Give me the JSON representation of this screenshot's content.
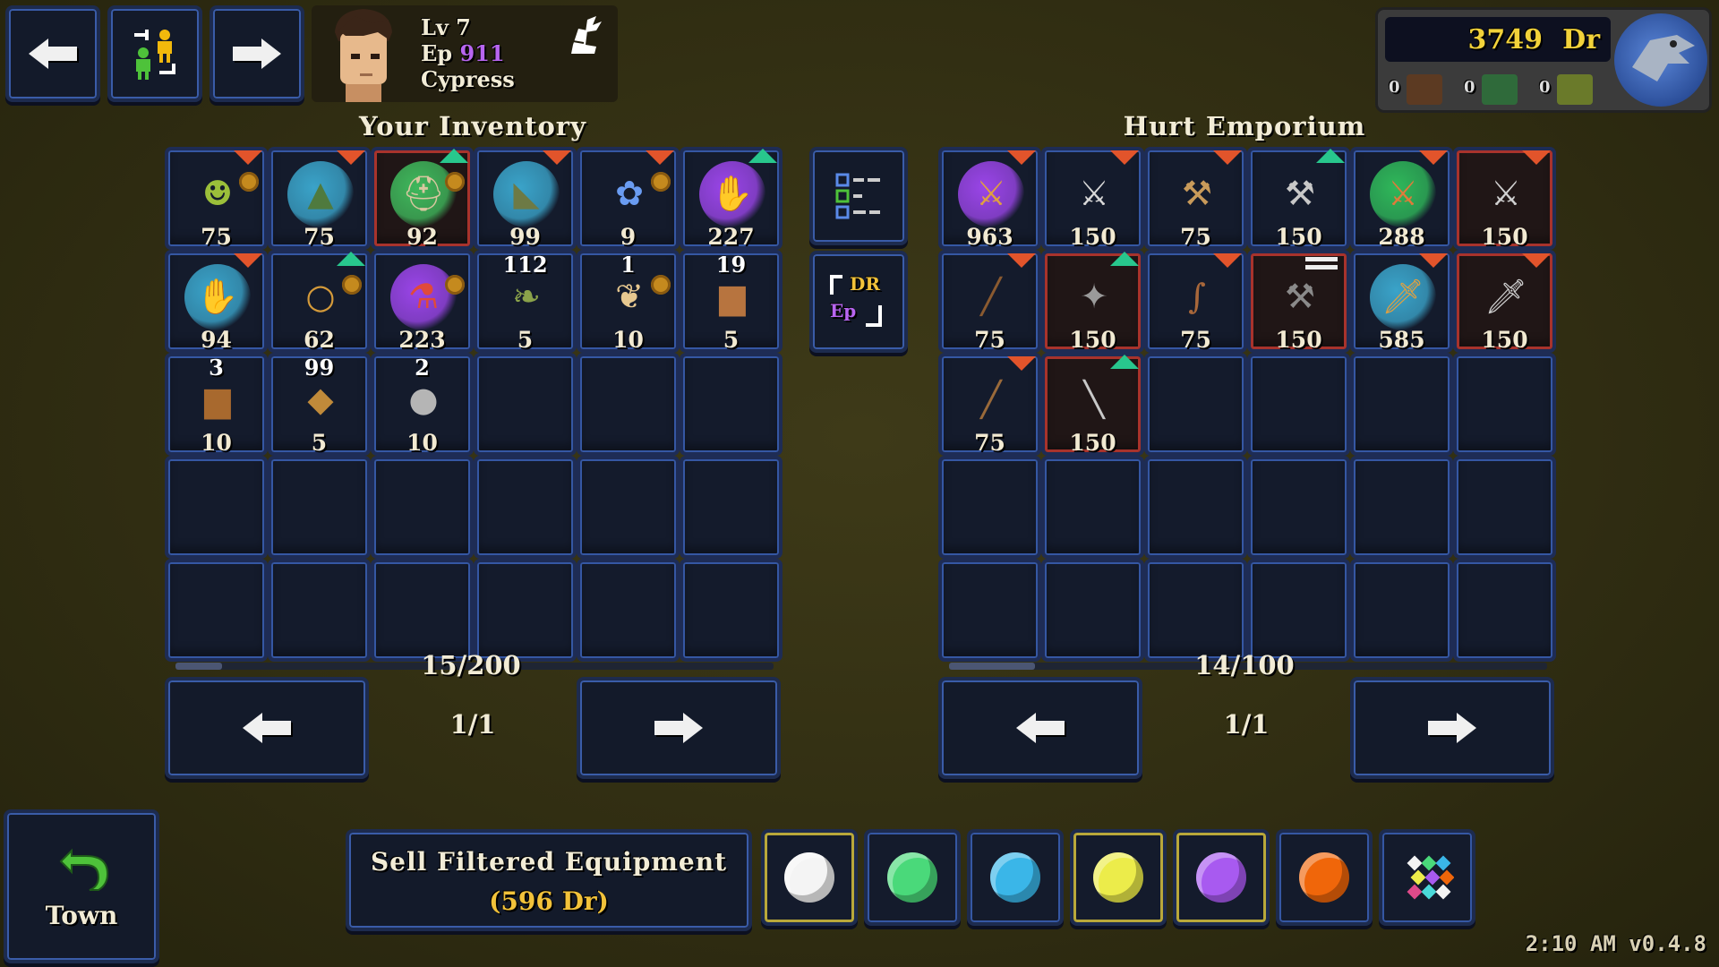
{
  "topbar": {
    "nav_back_icon": "arrow-left-icon",
    "swap_icon": "swap-characters-icon",
    "nav_forward_icon": "arrow-right-icon",
    "character": {
      "level_label": "Lv 7",
      "ep_label": "Ep",
      "ep_value": "911",
      "name": "Cypress",
      "ep_color": "#b865f0"
    },
    "class_icon": "winged-boot-icon"
  },
  "currency": {
    "amount": "3749",
    "unit": "Dr",
    "counts": [
      "0",
      "0",
      "0"
    ],
    "color": "#f2d23a"
  },
  "inventory": {
    "title": "Your Inventory",
    "capacity": "15/200",
    "page": "1/1",
    "slots": [
      {
        "icon": "goblin-mask-icon",
        "glyph": "☻",
        "color": "#9bbf3a",
        "qty": "75",
        "glow": "",
        "marker": "down",
        "coin": true
      },
      {
        "icon": "witch-hat-icon",
        "glyph": "▲",
        "color": "#4f7a3e",
        "qty": "75",
        "glow": "#3aa3c9",
        "marker": "down",
        "coin": false
      },
      {
        "icon": "helmet-icon",
        "glyph": "⛑",
        "color": "#d9c7a0",
        "qty": "92",
        "glow": "#3fb85c",
        "marker": "up",
        "coin": true,
        "red": true
      },
      {
        "icon": "boots-icon",
        "glyph": "◣",
        "color": "#6d7a45",
        "qty": "99",
        "glow": "#3aa3c9",
        "marker": "down",
        "coin": false
      },
      {
        "icon": "blue-flower-icon",
        "glyph": "✿",
        "color": "#6a9cf2",
        "qty": "9",
        "glow": "",
        "marker": "down",
        "coin": true
      },
      {
        "icon": "glove-icon",
        "glyph": "✋",
        "color": "#b9744a",
        "qty": "227",
        "glow": "#9a45e8",
        "marker": "up",
        "coin": false
      },
      {
        "icon": "glove-icon",
        "glyph": "✋",
        "color": "#c48450",
        "qty": "94",
        "glow": "#3aa3c9",
        "marker": "down",
        "coin": false
      },
      {
        "icon": "ring-icon",
        "glyph": "○",
        "color": "#d49a3a",
        "qty": "62",
        "glow": "",
        "marker": "up",
        "coin": true
      },
      {
        "icon": "potion-icon",
        "glyph": "⚗",
        "color": "#e04a3a",
        "qty": "223",
        "glow": "#9a45e8",
        "marker": "",
        "coin": true
      },
      {
        "icon": "leaf-icon",
        "glyph": "❧",
        "color": "#8aa24a",
        "qty": "5",
        "count": "112",
        "glow": "",
        "marker": "",
        "coin": false
      },
      {
        "icon": "feather-icon",
        "glyph": "❦",
        "color": "#e7c890",
        "qty": "10",
        "count": "1",
        "glow": "",
        "marker": "",
        "coin": true
      },
      {
        "icon": "leather-icon",
        "glyph": "▆",
        "color": "#b7743f",
        "qty": "5",
        "count": "19",
        "glow": "",
        "marker": "",
        "coin": false
      },
      {
        "icon": "leather-icon",
        "glyph": "▆",
        "color": "#a8692e",
        "qty": "10",
        "count": "3",
        "glow": "",
        "marker": "",
        "coin": false
      },
      {
        "icon": "ore-icon",
        "glyph": "◆",
        "color": "#c08a3a",
        "qty": "5",
        "count": "99",
        "glow": "",
        "marker": "",
        "coin": false
      },
      {
        "icon": "stone-icon",
        "glyph": "●",
        "color": "#b5b5b5",
        "qty": "10",
        "count": "2",
        "glow": "",
        "marker": "",
        "coin": false
      }
    ]
  },
  "middle": {
    "filter_icon": "filter-list-icon",
    "convert_icon": "convert-dr-ep-icon",
    "convert_top": "DR",
    "convert_bottom": "Ep"
  },
  "shop": {
    "title": "Hurt Emporium",
    "capacity": "14/100",
    "page": "1/1",
    "slots": [
      {
        "icon": "sword-icon",
        "glyph": "⚔",
        "color": "#e0a040",
        "qty": "963",
        "glow": "#9a45e8",
        "marker": "down"
      },
      {
        "icon": "sword-icon",
        "glyph": "⚔",
        "color": "#d8d8d8",
        "qty": "150",
        "glow": "",
        "marker": "down"
      },
      {
        "icon": "axe-icon",
        "glyph": "⚒",
        "color": "#c89a5a",
        "qty": "75",
        "glow": "",
        "marker": "down"
      },
      {
        "icon": "axe-icon",
        "glyph": "⚒",
        "color": "#c8c8c8",
        "qty": "150",
        "glow": "",
        "marker": "up"
      },
      {
        "icon": "sword-icon",
        "glyph": "⚔",
        "color": "#e07a3a",
        "qty": "288",
        "glow": "#2fb85a",
        "marker": "down"
      },
      {
        "icon": "sword-icon",
        "glyph": "⚔",
        "color": "#d0d0d0",
        "qty": "150",
        "glow": "",
        "marker": "down",
        "red": true
      },
      {
        "icon": "club-icon",
        "glyph": "╱",
        "color": "#8a5a30",
        "qty": "75",
        "glow": "",
        "marker": "down"
      },
      {
        "icon": "mace-icon",
        "glyph": "✦",
        "color": "#9a9a9a",
        "qty": "150",
        "glow": "",
        "marker": "up",
        "red": true
      },
      {
        "icon": "staff-icon",
        "glyph": "∫",
        "color": "#a8673a",
        "qty": "75",
        "glow": "",
        "marker": "down"
      },
      {
        "icon": "axe-icon",
        "glyph": "⚒",
        "color": "#8a8a8a",
        "qty": "150",
        "glow": "",
        "marker": "equal",
        "red": true
      },
      {
        "icon": "dagger-icon",
        "glyph": "🗡",
        "color": "#e0a040",
        "qty": "585",
        "glow": "#3aa3c9",
        "marker": "down"
      },
      {
        "icon": "dagger-icon",
        "glyph": "🗡",
        "color": "#d0d0d0",
        "qty": "150",
        "glow": "",
        "marker": "down",
        "red": true
      },
      {
        "icon": "spear-icon",
        "glyph": "╱",
        "color": "#9a6a3a",
        "qty": "75",
        "glow": "",
        "marker": "down"
      },
      {
        "icon": "spear-icon",
        "glyph": "╲",
        "color": "#c8c8c8",
        "qty": "150",
        "glow": "",
        "marker": "up",
        "red": true
      }
    ]
  },
  "bottom": {
    "town_label": "Town",
    "sell_label": "Sell Filtered Equipment",
    "sell_value": "(596 Dr)",
    "sell_value_color": "#f2c23a",
    "filters": [
      {
        "name": "white-filter",
        "color": "#f4f4f4",
        "selected": true
      },
      {
        "name": "green-filter",
        "color": "#4ad97a",
        "selected": false
      },
      {
        "name": "blue-filter",
        "color": "#3ab6e8",
        "selected": false
      },
      {
        "name": "yellow-filter",
        "color": "#ecec4a",
        "selected": true
      },
      {
        "name": "purple-filter",
        "color": "#a85af0",
        "selected": true
      },
      {
        "name": "orange-filter",
        "color": "#f0660a",
        "selected": false
      },
      {
        "name": "all-rarities-filter",
        "color": "multi",
        "selected": false
      }
    ],
    "footer": "2:10 AM v0.4.8"
  }
}
